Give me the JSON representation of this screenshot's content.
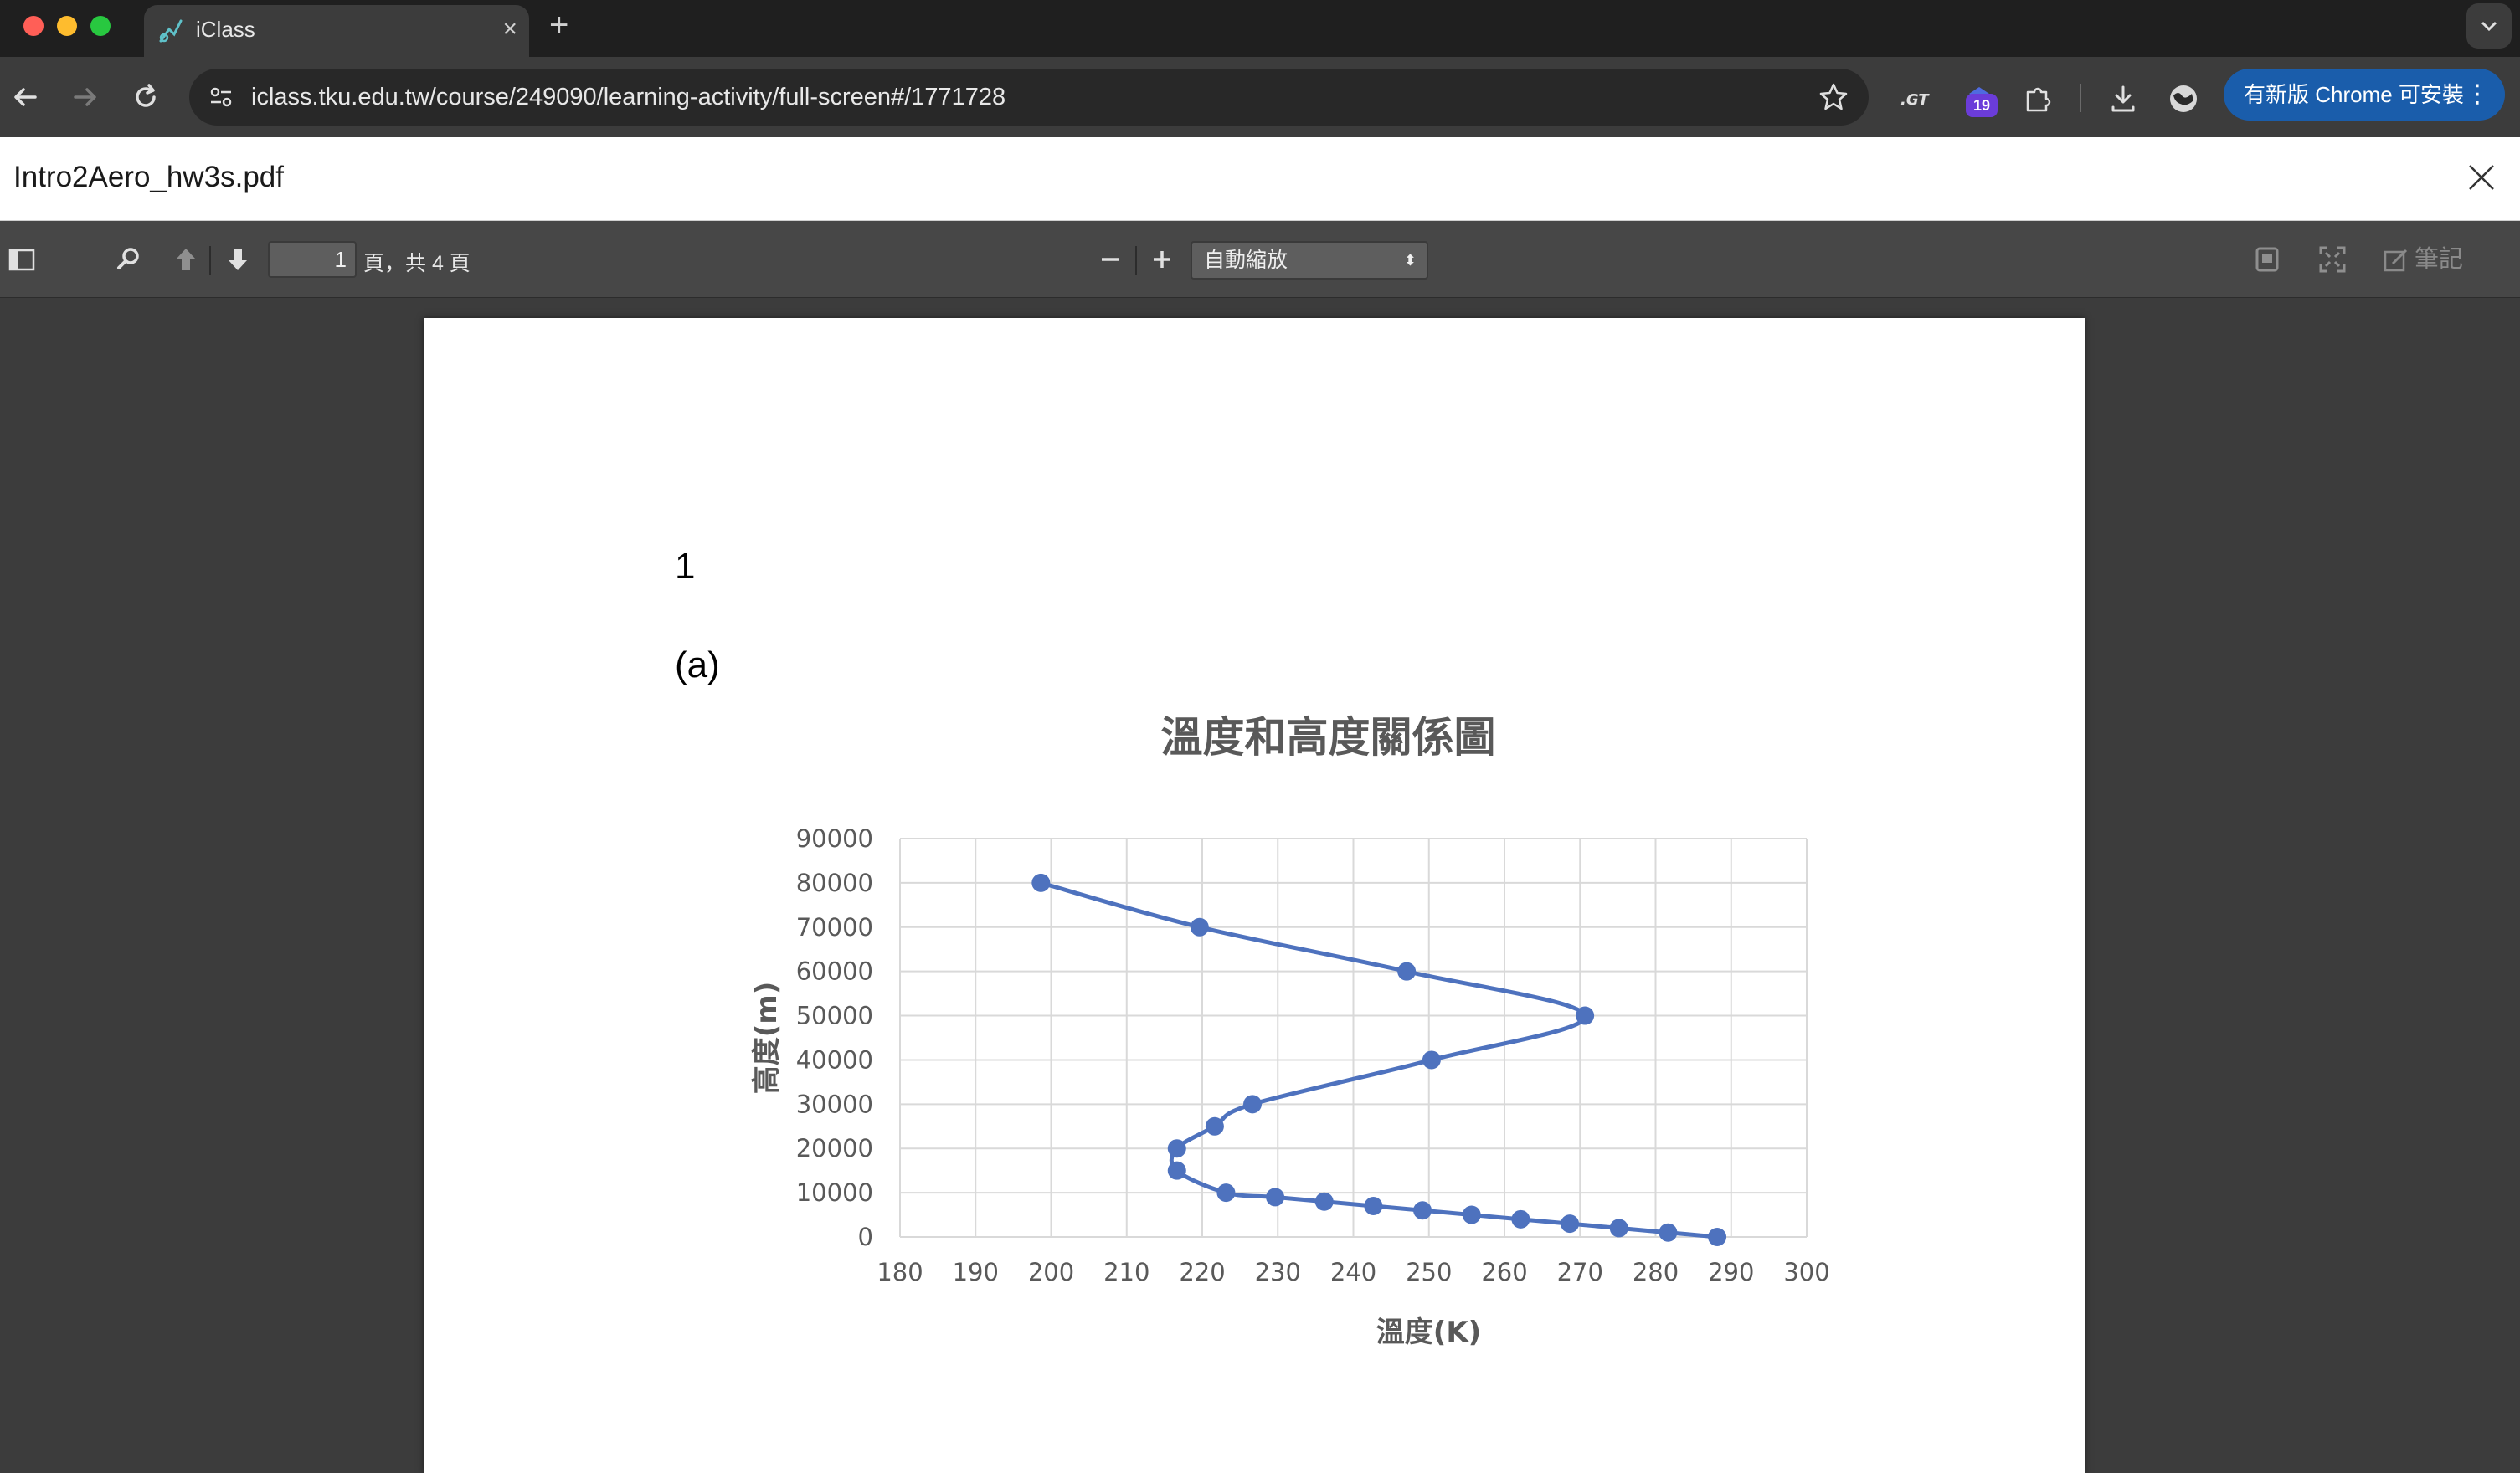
{
  "browser": {
    "tab_title": "iClass",
    "url": "iclass.tku.edu.tw/course/249090/learning-activity/full-screen#/1771728",
    "extension_badge": "19",
    "update_label": "有新版 Chrome 可安裝"
  },
  "viewer": {
    "file_name": "Intro2Aero_hw3s.pdf"
  },
  "pdf_toolbar": {
    "page_value": "1",
    "page_count_label": "頁，共 4 頁",
    "zoom_label": "自動縮放",
    "notes_label": "筆記"
  },
  "document": {
    "question_number": "1",
    "question_part": "(a)"
  },
  "colors": {
    "series": "#4e72be",
    "grid": "#d9d9d9",
    "axis_text": "#595959"
  },
  "chart_data": {
    "type": "scatter",
    "title": "溫度和高度關係圖",
    "xlabel": "溫度(K)",
    "ylabel": "高度(m)",
    "xlim": [
      180,
      300
    ],
    "ylim": [
      0,
      90000
    ],
    "x_ticks": [
      180,
      190,
      200,
      210,
      220,
      230,
      240,
      250,
      260,
      270,
      280,
      290,
      300
    ],
    "y_ticks": [
      0,
      10000,
      20000,
      30000,
      40000,
      50000,
      60000,
      70000,
      80000,
      90000
    ],
    "grid": true,
    "series": [
      {
        "points": [
          [
            288.15,
            0
          ],
          [
            281.65,
            1000
          ],
          [
            275.15,
            2000
          ],
          [
            268.65,
            3000
          ],
          [
            262.15,
            4000
          ],
          [
            255.65,
            5000
          ],
          [
            249.15,
            6000
          ],
          [
            242.65,
            7000
          ],
          [
            236.15,
            8000
          ],
          [
            229.65,
            9000
          ],
          [
            223.15,
            10000
          ],
          [
            216.65,
            15000
          ],
          [
            216.65,
            20000
          ],
          [
            221.65,
            25000
          ],
          [
            226.65,
            30000
          ],
          [
            250.35,
            40000
          ],
          [
            270.65,
            50000
          ],
          [
            247.05,
            60000
          ],
          [
            219.65,
            70000
          ],
          [
            198.65,
            80000
          ]
        ]
      }
    ]
  }
}
